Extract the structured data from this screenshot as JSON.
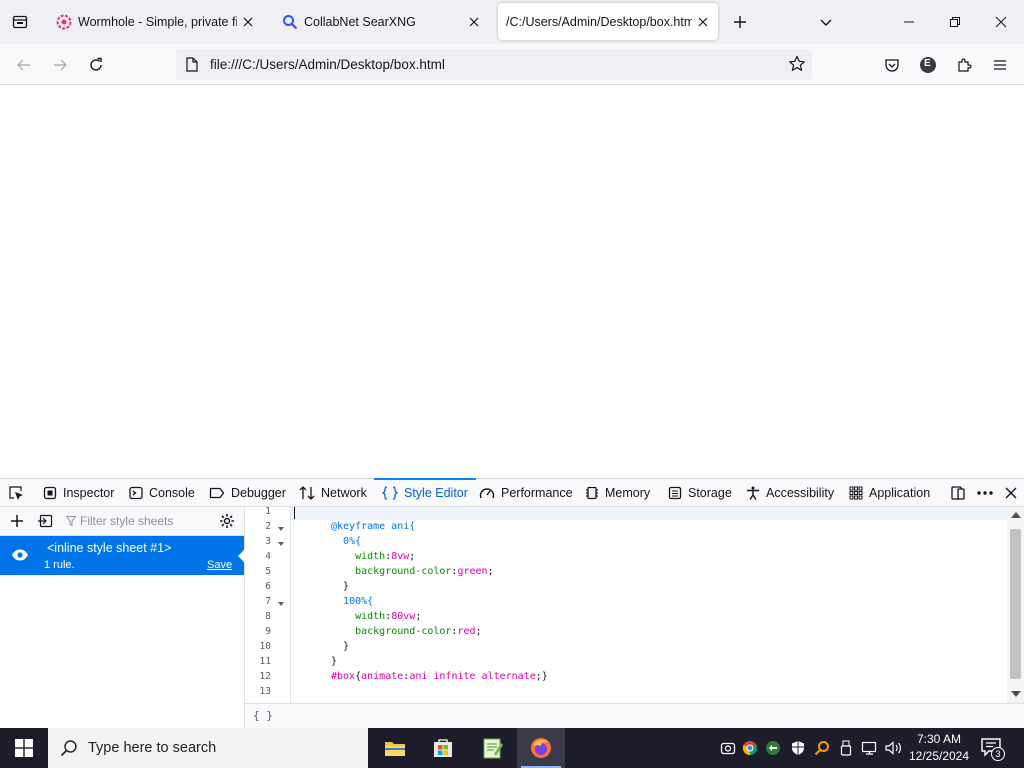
{
  "browser": {
    "tabs": [
      {
        "title": "Wormhole - Simple, private file",
        "favicon": "wormhole-icon",
        "active": false
      },
      {
        "title": "CollabNet SearXNG",
        "favicon": "search-icon",
        "active": false
      },
      {
        "title": "/C:/Users/Admin/Desktop/box.htm",
        "favicon": "",
        "active": true
      }
    ],
    "url": "file:///C:/Users/Admin/Desktop/box.html",
    "account_initial": "E"
  },
  "devtools": {
    "tabs": [
      {
        "label": "Inspector",
        "icon": "inspector-icon"
      },
      {
        "label": "Console",
        "icon": "console-icon"
      },
      {
        "label": "Debugger",
        "icon": "debugger-icon"
      },
      {
        "label": "Network",
        "icon": "network-icon"
      },
      {
        "label": "Style Editor",
        "icon": "braces-icon",
        "selected": true
      },
      {
        "label": "Performance",
        "icon": "performance-icon"
      },
      {
        "label": "Memory",
        "icon": "memory-icon"
      },
      {
        "label": "Storage",
        "icon": "storage-icon"
      },
      {
        "label": "Accessibility",
        "icon": "accessibility-icon"
      },
      {
        "label": "Application",
        "icon": "application-icon"
      }
    ],
    "sheets": {
      "filter_placeholder": "Filter style sheets",
      "items": [
        {
          "name": "<inline style sheet #1>",
          "rules": "1 rule.",
          "save_label": "Save"
        }
      ]
    },
    "editor": {
      "line_numbers": [
        "1",
        "2",
        "3",
        "4",
        "5",
        "6",
        "7",
        "8",
        "9",
        "10",
        "11",
        "12",
        "13"
      ],
      "lines": [
        "",
        "@keyframe ani{",
        "  0%{",
        "    width:8vw;",
        "    background-color:green;",
        "  }",
        "  100%{",
        "    width:80vw;",
        "    background-color:red;",
        "  }",
        "}",
        "#box{animate:ani infnite alternate;}",
        ""
      ],
      "footer": "{ }"
    }
  },
  "taskbar": {
    "search_placeholder": "Type here to search",
    "time": "7:30 AM",
    "date": "12/25/2024",
    "notification_count": "3"
  }
}
